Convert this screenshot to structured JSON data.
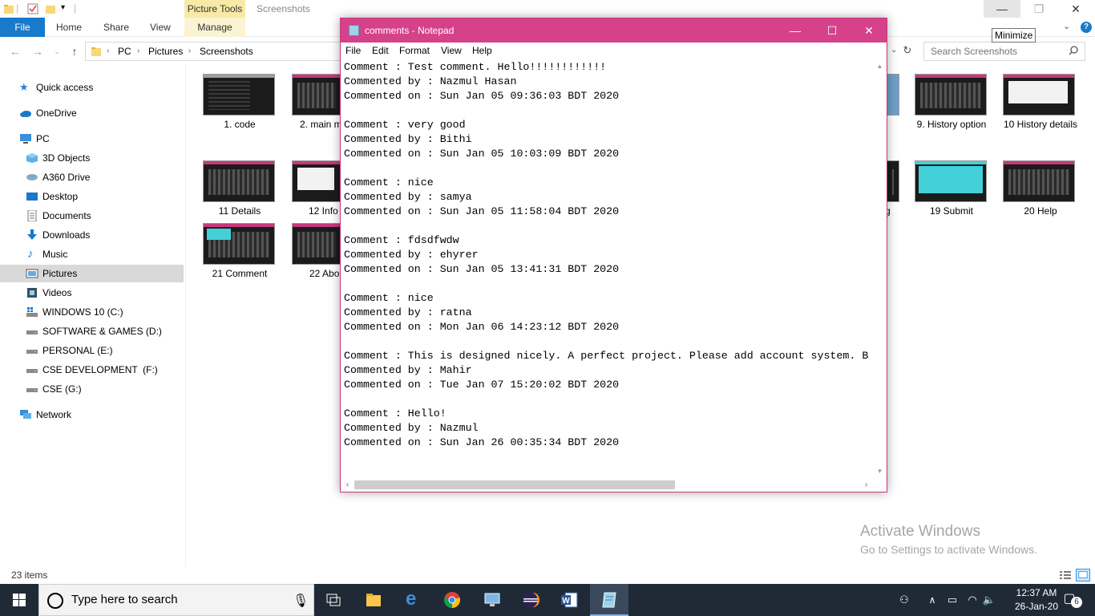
{
  "explorer": {
    "ribbon": {
      "context_tab": "Picture Tools",
      "window_title": "Screenshots",
      "tabs": [
        "File",
        "Home",
        "Share",
        "View",
        "Manage"
      ]
    },
    "tooltip": "Minimize",
    "breadcrumb": [
      "PC",
      "Pictures",
      "Screenshots"
    ],
    "search_placeholder": "Search Screenshots",
    "nav": [
      {
        "label": "Quick access",
        "icon": "star-icon"
      },
      {
        "label": "OneDrive",
        "icon": "cloud-icon"
      },
      {
        "label": "PC",
        "icon": "pc-icon"
      },
      {
        "label": "3D Objects",
        "icon": "cube-icon"
      },
      {
        "label": "A360 Drive",
        "icon": "network-drive-icon"
      },
      {
        "label": "Desktop",
        "icon": "desktop-icon"
      },
      {
        "label": "Documents",
        "icon": "documents-icon"
      },
      {
        "label": "Downloads",
        "icon": "download-icon"
      },
      {
        "label": "Music",
        "icon": "music-icon"
      },
      {
        "label": "Pictures",
        "icon": "pictures-icon"
      },
      {
        "label": "Videos",
        "icon": "video-icon"
      },
      {
        "label": "WINDOWS 10 (C:)",
        "icon": "windows-drive-icon"
      },
      {
        "label": "SOFTWARE & GAMES (D:)",
        "icon": "drive-icon"
      },
      {
        "label": "PERSONAL (E:)",
        "icon": "drive-icon"
      },
      {
        "label": "CSE DEVELOPMENT  (F:)",
        "icon": "drive-icon"
      },
      {
        "label": "CSE (G:)",
        "icon": "drive-icon"
      },
      {
        "label": "Network",
        "icon": "network-icon"
      }
    ],
    "files": [
      {
        "label": "1. code"
      },
      {
        "label": "2. main m"
      },
      {
        "label": "9. History option"
      },
      {
        "label": "10 History details"
      },
      {
        "label": "11 Details"
      },
      {
        "label": "12 Info"
      },
      {
        "label": "g"
      },
      {
        "label": "19 Submit"
      },
      {
        "label": "20 Help"
      },
      {
        "label": "21 Comment"
      },
      {
        "label": "22 Abo"
      }
    ],
    "status_count": "23 items",
    "watermark": {
      "title": "Activate Windows",
      "subtitle": "Go to Settings to activate Windows."
    }
  },
  "notepad": {
    "title": "comments - Notepad",
    "menu": [
      "File",
      "Edit",
      "Format",
      "View",
      "Help"
    ],
    "lines": [
      "Comment : Test comment. Hello!!!!!!!!!!!!",
      "Commented by : Nazmul Hasan",
      "Commented on : Sun Jan 05 09:36:03 BDT 2020",
      "",
      "Comment : very good",
      "Commented by : Bithi",
      "Commented on : Sun Jan 05 10:03:09 BDT 2020",
      "",
      "Comment : nice",
      "Commented by : samya",
      "Commented on : Sun Jan 05 11:58:04 BDT 2020",
      "",
      "Comment : fdsdfwdw",
      "Commented by : ehyrer",
      "Commented on : Sun Jan 05 13:41:31 BDT 2020",
      "",
      "Comment : nice",
      "Commented by : ratna",
      "Commented on : Mon Jan 06 14:23:12 BDT 2020",
      "",
      "Comment : This is designed nicely. A perfect project. Please add account system. B",
      "Commented by : Mahir",
      "Commented on : Tue Jan 07 15:20:02 BDT 2020",
      "",
      "Comment : Hello!",
      "Commented by : Nazmul",
      "Commented on : Sun Jan 26 00:35:34 BDT 2020"
    ]
  },
  "taskbar": {
    "search_placeholder": "Type here to search",
    "apps": [
      "file-explorer-icon",
      "edge-icon",
      "chrome-icon",
      "remote-desktop-icon",
      "eclipse-icon",
      "word-icon",
      "notepad-icon"
    ],
    "time": "12:37 AM",
    "date": "26-Jan-20",
    "notification_count": "6"
  },
  "colors": {
    "notepad_title": "#d6428a",
    "accent": "#1979ca",
    "taskbar": "#1f2a36"
  }
}
